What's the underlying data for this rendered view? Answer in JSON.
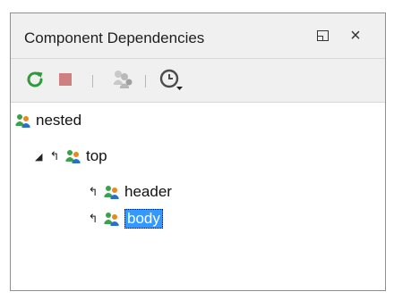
{
  "panel": {
    "title": "Component Dependencies",
    "window_controls": {
      "restore_icon": "restore-icon",
      "close_icon": "close-icon",
      "close_label": "×"
    }
  },
  "toolbar": {
    "refresh_icon": "refresh-icon",
    "stop_icon": "stop-icon",
    "show_dependencies_icon": "show-dependencies-icon",
    "history_icon": "history-icon"
  },
  "tree": {
    "root": {
      "label": "nested"
    },
    "child": {
      "label": "top",
      "expanded": true
    },
    "grandchildren": [
      {
        "label": "header",
        "selected": false
      },
      {
        "label": "body",
        "selected": true
      }
    ]
  },
  "colors": {
    "selection": "#3399ff",
    "refresh": "#2e9b3a",
    "stop": "#cf7f7f"
  }
}
